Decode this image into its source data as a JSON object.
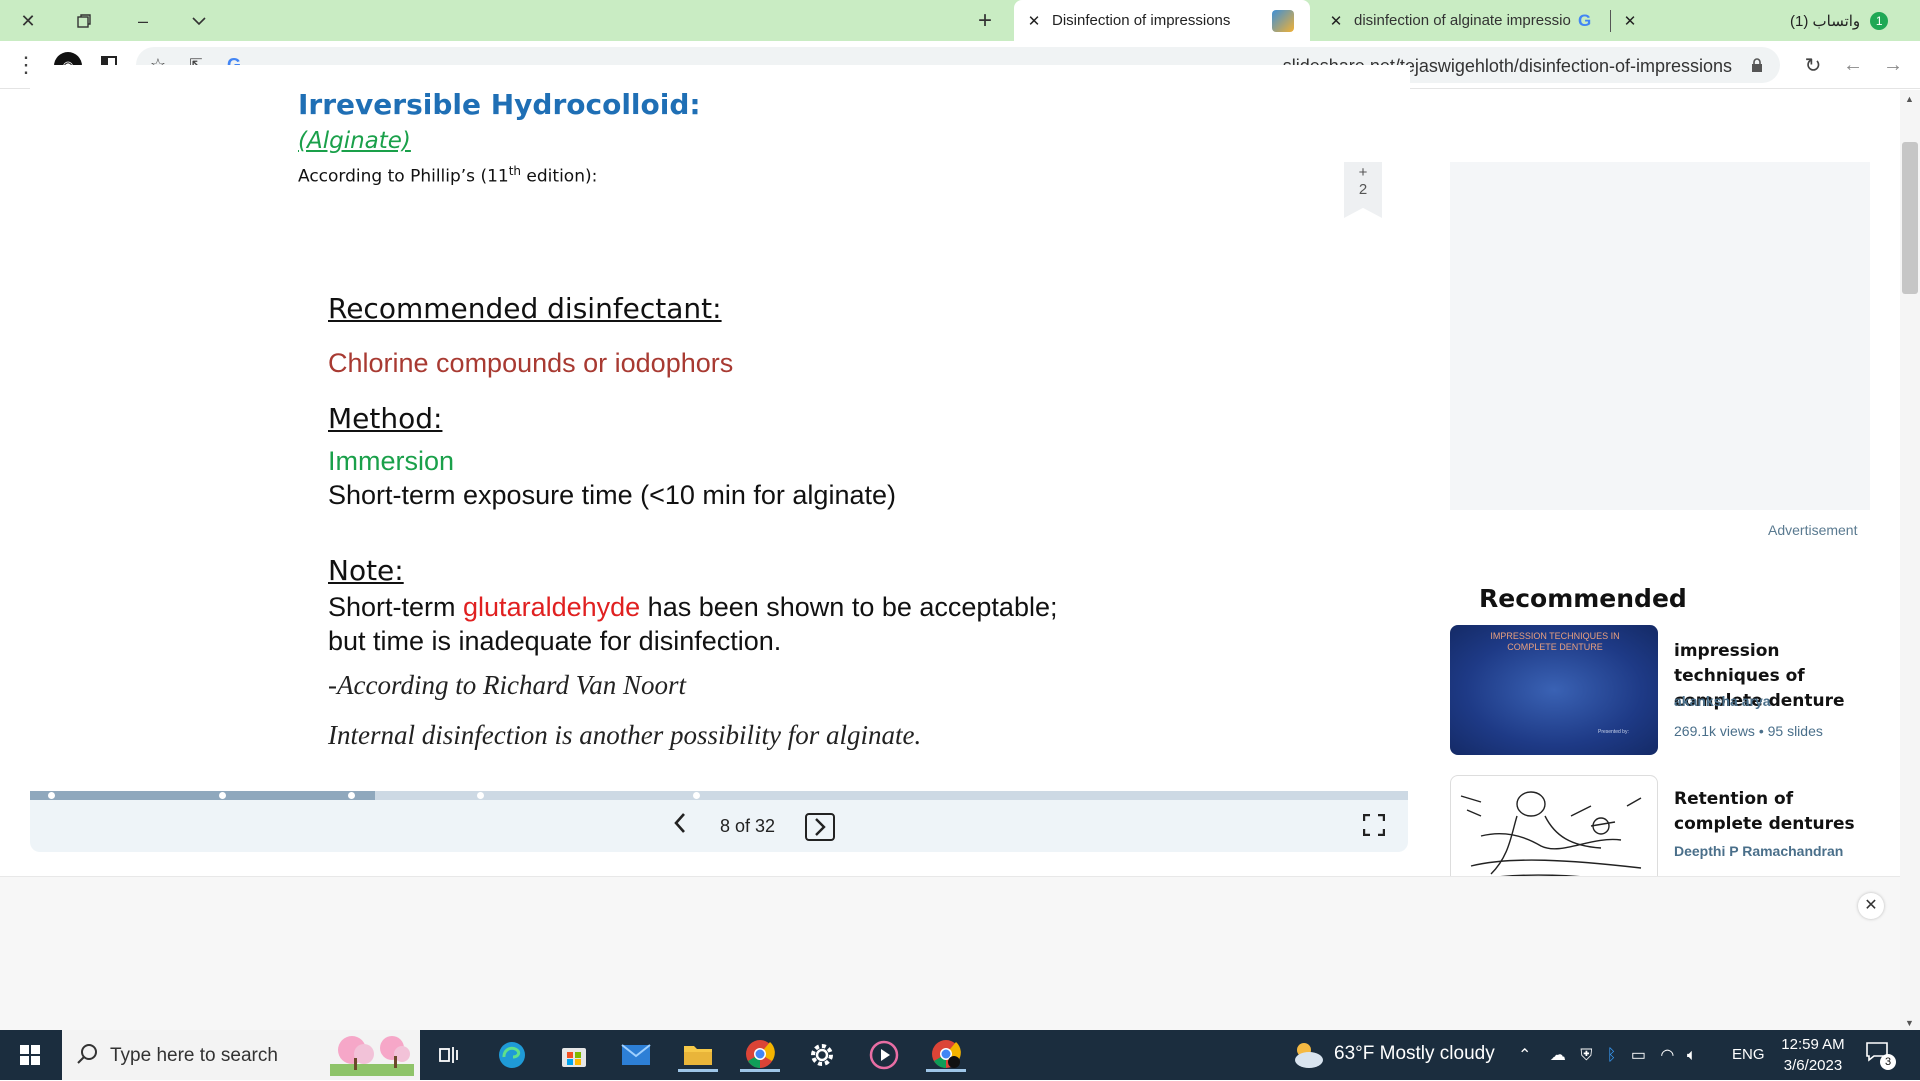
{
  "browser": {
    "tabs": [
      {
        "title": "Disinfection of impressions",
        "active": true
      },
      {
        "title": "disinfection of alginate impressio",
        "active": false
      },
      {
        "title": "(1) واتساب",
        "active": false,
        "badge": "1"
      }
    ],
    "url": "slideshare.net/tejaswigehloth/disinfection-of-impressions",
    "icons": [
      "close-window-icon",
      "restore-icon",
      "minimize-icon",
      "chevron-down-icon",
      "new-tab-icon",
      "menu-dots-icon",
      "extension-icon",
      "sidebar-icon",
      "star-icon",
      "share-icon",
      "google-icon",
      "lock-icon",
      "reload-icon",
      "back-icon",
      "forward-icon"
    ]
  },
  "slide": {
    "title": "Irreversible Hydrocolloid:",
    "subtitle": "(Alginate)",
    "source_prefix": "According to Phillip’s (11",
    "source_sup": "th",
    "source_suffix": " edition):",
    "recommended_heading": "Recommended disinfectant:",
    "recommended_value": "Chlorine compounds or iodophors",
    "method_heading": "Method:",
    "method_value": "Immersion",
    "method_detail": "Short-term exposure time (<10 min for alginate)",
    "note_heading": "Note:",
    "note_line1_a": "Short-term ",
    "note_line1_highlight": "glutaraldehyde",
    "note_line1_b": " has been shown to be acceptable;",
    "note_line2": "but time is inadequate for disinfection.",
    "quote": "-According to Richard Van Noort",
    "closing": "Internal disinfection is another possibility for alginate.",
    "colors": {
      "title": "#1f6fb5",
      "subtitle": "#1aa04a",
      "recommended": "#a83a32",
      "method": "#1aa04a",
      "highlight": "#e02020"
    }
  },
  "bookmark": {
    "plus": "+",
    "count": "2"
  },
  "viewer": {
    "counter": "8 of 32",
    "current_slide": 8,
    "total_slides": 32
  },
  "sidebar": {
    "ad_label": "Advertisement",
    "recommended_heading": "Recommended",
    "cards": [
      {
        "title": "impression techniques of complete denture",
        "author": "akanksha arya",
        "meta": "269.1k views • 95 slides",
        "thumb_caption": "IMPRESSION TECHNIQUES IN COMPLETE DENTURE",
        "thumb_footer": "Presented by:"
      },
      {
        "title": "Retention of complete dentures",
        "author": "Deepthi P Ramachandran"
      }
    ]
  },
  "taskbar": {
    "search_placeholder": "Type here to search",
    "weather": "63°F  Mostly cloudy",
    "language": "ENG",
    "time": "12:59 AM",
    "date": "3/6/2023",
    "notification_count": "3",
    "apps": [
      "task-view-icon",
      "edge-icon",
      "store-icon",
      "mail-icon",
      "file-explorer-icon",
      "chrome-icon",
      "settings-icon",
      "media-player-icon",
      "chrome-profile-icon"
    ]
  }
}
